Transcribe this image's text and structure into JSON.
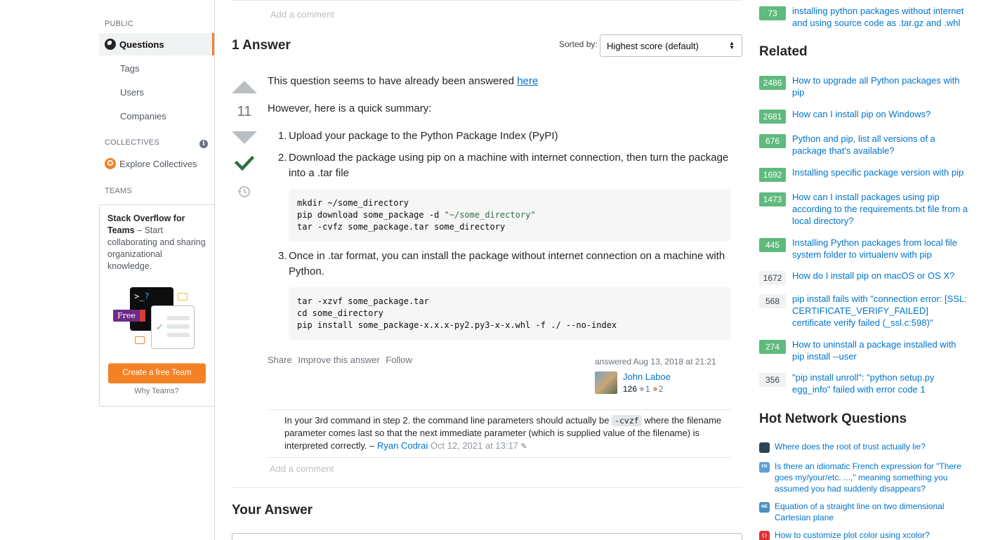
{
  "sidebar": {
    "public_label": "PUBLIC",
    "questions": "Questions",
    "tags": "Tags",
    "users": "Users",
    "companies": "Companies",
    "collectives_label": "COLLECTIVES",
    "explore_collectives": "Explore Collectives",
    "teams_label": "TEAMS",
    "teams_title": "Stack Overflow for Teams",
    "teams_desc": " – Start collaborating and sharing organizational knowledge.",
    "free_badge": "Free",
    "create_team": "Create a free Team",
    "why_teams": "Why Teams?"
  },
  "main": {
    "add_comment": "Add a comment",
    "answers_count": "1 Answer",
    "sorted_by": "Sorted by:",
    "sort_value": "Highest score (default)",
    "vote_count": "11",
    "intro_text": "This question seems to have already been answered ",
    "intro_link": "here",
    "summary": "However, here is a quick summary:",
    "steps": [
      {
        "num": "1.",
        "text": "Upload your package to the Python Package Index (PyPI)"
      },
      {
        "num": "2.",
        "text": "Download the package using pip on a machine with internet connection, then turn the package into a .tar file"
      },
      {
        "num": "3.",
        "text": "Once in .tar format, you can install the package without internet connection on a machine with Python."
      }
    ],
    "code1": {
      "line1": "mkdir ~/some_directory",
      "line2_a": "pip download some_package -d ",
      "line2_b": "\"~/some_directory\"",
      "line3": "tar -cvfz some_package.tar some_directory"
    },
    "code2": {
      "line1": "tar -xzvf some_package.tar",
      "line2": "cd some_directory",
      "line3": "pip install some_package-x.x.x-py2.py3-x-x.whl -f ./ --no-index"
    },
    "share": "Share",
    "improve": "Improve this answer",
    "follow": "Follow",
    "answered": "answered Aug 13, 2018 at 21:21",
    "user_name": "John Laboe",
    "user_rep": "126",
    "silver": "1",
    "bronze": "2",
    "comment": {
      "text_a": "In your 3rd command in step 2. the command line parameters should actually be ",
      "code": "-cvzf",
      "text_b": " where the filename parameter comes last so that the next immediate parameter (which is supplied value of the filename) is interpreted correctly. – ",
      "user": "Ryan Codrai",
      "date": "Oct 12, 2021 at 13:17"
    },
    "your_answer": "Your Answer"
  },
  "right": {
    "top_linked": {
      "score": "73",
      "title": "installing python packages without internet and using source code as .tar.gz and .whl"
    },
    "related_heading": "Related",
    "related": [
      {
        "score": "2486",
        "answered": true,
        "title": "How to upgrade all Python packages with pip"
      },
      {
        "score": "2681",
        "answered": true,
        "title": "How can I install pip on Windows?"
      },
      {
        "score": "676",
        "answered": true,
        "title": "Python and pip, list all versions of a package that's available?"
      },
      {
        "score": "1692",
        "answered": true,
        "title": "Installing specific package version with pip"
      },
      {
        "score": "1473",
        "answered": true,
        "title": "How can I install packages using pip according to the requirements.txt file from a local directory?"
      },
      {
        "score": "445",
        "answered": true,
        "title": "Installing Python packages from local file system folder to virtualenv with pip"
      },
      {
        "score": "1672",
        "answered": false,
        "title": "How do I install pip on macOS or OS X?"
      },
      {
        "score": "568",
        "answered": false,
        "title": "pip install fails with \"connection error: [SSL: CERTIFICATE_VERIFY_FAILED] certificate verify failed (_ssl.c:598)\""
      },
      {
        "score": "274",
        "answered": true,
        "title": "How to uninstall a package installed with pip install --user"
      },
      {
        "score": "356",
        "answered": false,
        "title": "\"pip install unroll\": \"python setup.py egg_info\" failed with error code 1"
      }
    ],
    "hnq_heading": "Hot Network Questions",
    "hnq": [
      {
        "icon": "security-se-icon",
        "color": "#2d4654",
        "title": "Where does the root of trust actually lie?"
      },
      {
        "icon": "french-se-icon",
        "color": "#5c9fd8",
        "title": "Is there an idiomatic French expression for \"There goes my/your/etc. ...,\" meaning something you assumed you had suddenly disappears?"
      },
      {
        "icon": "math-educators-se-icon",
        "color": "#4a8fc4",
        "title": "Equation of a straight line on two dimensional Cartesian plane"
      },
      {
        "icon": "tex-se-icon",
        "color": "#d33",
        "title": "How to customize plot color using xcolor?"
      }
    ]
  },
  "colors": {
    "accent": "#f48225",
    "link": "#0074cc",
    "answered_green": "#5eba7d",
    "silver": "#b4b8bc",
    "bronze": "#d1a684"
  }
}
